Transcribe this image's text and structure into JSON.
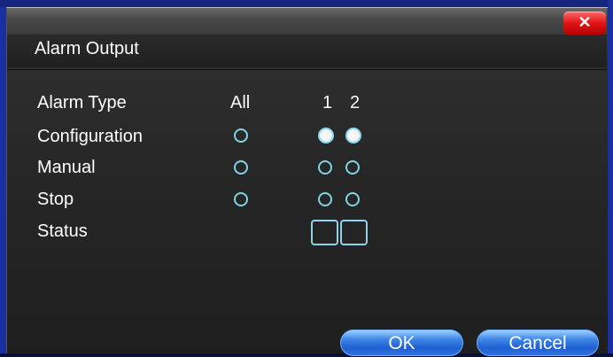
{
  "window": {
    "title": "Alarm Output",
    "close_glyph": "✕"
  },
  "table": {
    "row_labels": [
      "Alarm Type",
      "Configuration",
      "Manual",
      "Stop",
      "Status"
    ],
    "col_all": "All",
    "col_1": "1",
    "col_2": "2"
  },
  "buttons": {
    "ok": "OK",
    "cancel": "Cancel"
  },
  "state": {
    "configuration": "channel-1-and-2",
    "manual": "none",
    "stop": "none"
  },
  "colors": {
    "accent_button": "#2d74e0",
    "radio_outline": "#7fd4e8",
    "close_red": "#e01515"
  }
}
